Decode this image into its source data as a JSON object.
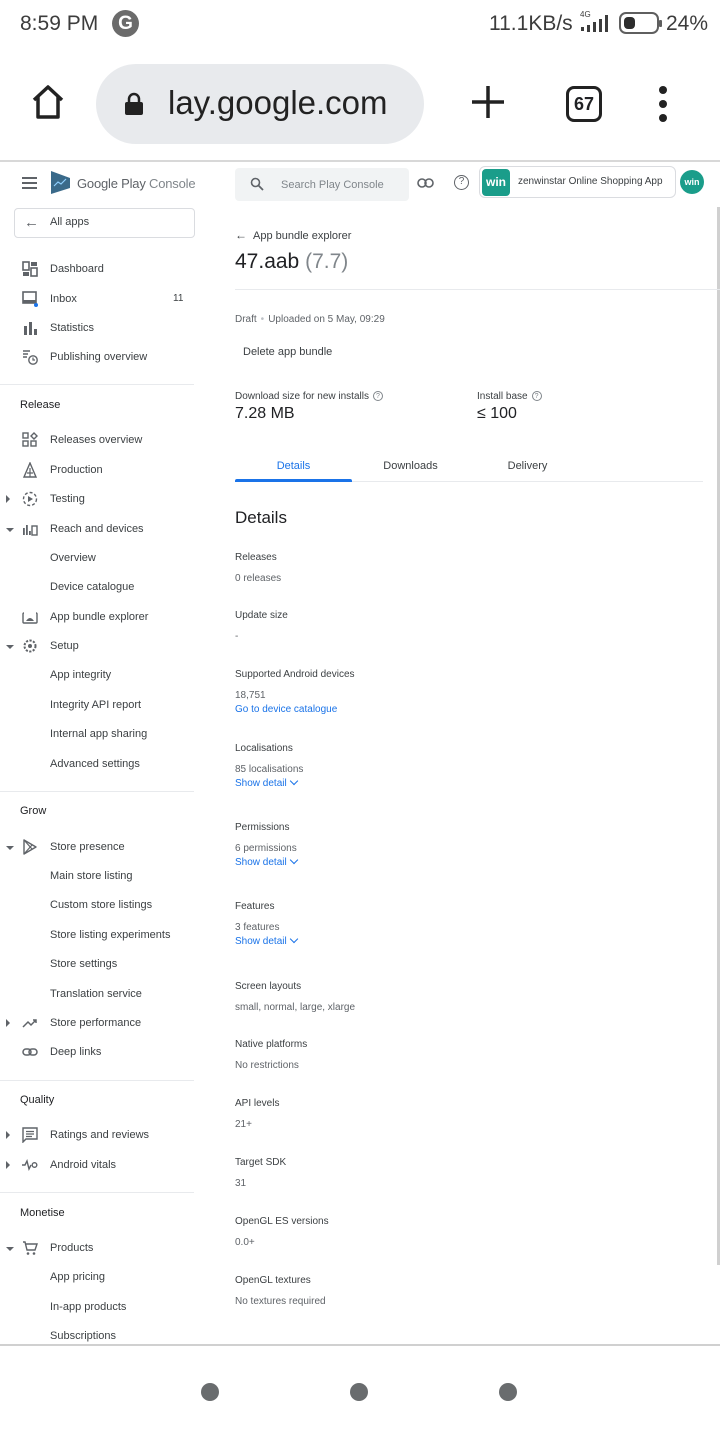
{
  "status_bar": {
    "time": "8:59 PM",
    "notification_icon": "G",
    "network_speed": "11.1KB/s",
    "network_type": "4G",
    "battery_percent": "24%"
  },
  "browser": {
    "url": "lay.google.com",
    "tab_count": "67"
  },
  "sidebar": {
    "brand_main": "Google Play",
    "brand_sub": "Console",
    "all_apps": "All apps",
    "top_items": [
      {
        "label": "Dashboard",
        "icon": "dashboard-icon"
      },
      {
        "label": "Inbox",
        "icon": "inbox-icon",
        "badge": "11"
      },
      {
        "label": "Statistics",
        "icon": "statistics-icon"
      },
      {
        "label": "Publishing overview",
        "icon": "publishing-overview-icon"
      }
    ],
    "sections": [
      {
        "title": "Release",
        "items": [
          {
            "label": "Releases overview",
            "icon": "releases-overview-icon"
          },
          {
            "label": "Production",
            "icon": "production-icon"
          },
          {
            "label": "Testing",
            "icon": "testing-icon",
            "expander": "collapsed"
          },
          {
            "label": "Reach and devices",
            "icon": "reach-devices-icon",
            "expander": "expanded"
          },
          {
            "label": "Overview",
            "sub": true
          },
          {
            "label": "Device catalogue",
            "sub": true
          },
          {
            "label": "App bundle explorer",
            "icon": "app-bundle-explorer-icon"
          },
          {
            "label": "Setup",
            "icon": "setup-gear-icon",
            "expander": "expanded"
          },
          {
            "label": "App integrity",
            "sub": true
          },
          {
            "label": "Integrity API report",
            "sub": true
          },
          {
            "label": "Internal app sharing",
            "sub": true
          },
          {
            "label": "Advanced settings",
            "sub": true
          }
        ]
      },
      {
        "title": "Grow",
        "items": [
          {
            "label": "Store presence",
            "icon": "store-presence-icon",
            "expander": "expanded"
          },
          {
            "label": "Main store listing",
            "sub": true
          },
          {
            "label": "Custom store listings",
            "sub": true
          },
          {
            "label": "Store listing experiments",
            "sub": true
          },
          {
            "label": "Store settings",
            "sub": true
          },
          {
            "label": "Translation service",
            "sub": true
          },
          {
            "label": "Store performance",
            "icon": "store-performance-icon",
            "expander": "collapsed"
          },
          {
            "label": "Deep links",
            "icon": "deep-links-icon"
          }
        ]
      },
      {
        "title": "Quality",
        "items": [
          {
            "label": "Ratings and reviews",
            "icon": "ratings-reviews-icon",
            "expander": "collapsed"
          },
          {
            "label": "Android vitals",
            "icon": "android-vitals-icon",
            "expander": "collapsed"
          }
        ]
      },
      {
        "title": "Monetise",
        "items": [
          {
            "label": "Products",
            "icon": "cart-icon",
            "expander": "expanded"
          },
          {
            "label": "App pricing",
            "sub": true
          },
          {
            "label": "In-app products",
            "sub": true
          },
          {
            "label": "Subscriptions",
            "sub": true
          }
        ]
      }
    ]
  },
  "header": {
    "search_placeholder": "Search Play Console",
    "app_name": "zenwinstar Online Shopping App",
    "app_icon_text": "win",
    "avatar_text": "win"
  },
  "page": {
    "breadcrumb": "App bundle explorer",
    "title": "47.aab",
    "version": "(7.7)",
    "status": "Draft",
    "uploaded": "Uploaded on 5 May, 09:29",
    "delete_button": "Delete app bundle",
    "download_size_label": "Download size for new installs",
    "download_size_value": "7.28 MB",
    "install_base_label": "Install base",
    "install_base_value": "≤ 100",
    "tabs": [
      "Details",
      "Downloads",
      "Delivery"
    ],
    "active_tab": "Details",
    "details_heading": "Details",
    "details": [
      {
        "label": "Releases",
        "value": "0 releases"
      },
      {
        "label": "Update size",
        "value": "-"
      },
      {
        "label": "Supported Android devices",
        "value": "18,751",
        "link": "Go to device catalogue"
      },
      {
        "label": "Localisations",
        "value": "85 localisations",
        "link": "Show detail"
      },
      {
        "label": "Permissions",
        "value": "6 permissions",
        "link": "Show detail"
      },
      {
        "label": "Features",
        "value": "3 features",
        "link": "Show detail"
      },
      {
        "label": "Screen layouts",
        "value": "small, normal, large, xlarge"
      },
      {
        "label": "Native platforms",
        "value": "No restrictions"
      },
      {
        "label": "API levels",
        "value": "21+"
      },
      {
        "label": "Target SDK",
        "value": "31"
      },
      {
        "label": "OpenGL ES versions",
        "value": "0.0+"
      },
      {
        "label": "OpenGL textures",
        "value": "No textures required"
      }
    ]
  }
}
